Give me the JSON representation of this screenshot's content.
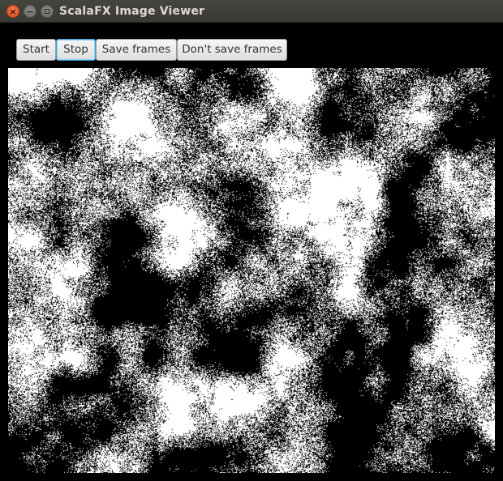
{
  "window": {
    "title": "ScalaFX Image Viewer",
    "controls": {
      "close_glyph": "×",
      "minimize_glyph": "−"
    }
  },
  "toolbar": {
    "buttons": [
      {
        "label": "Start"
      },
      {
        "label": "Stop",
        "focused": true
      },
      {
        "label": "Save frames"
      },
      {
        "label": "Don't save frames"
      }
    ]
  },
  "image": {
    "description_colors": {
      "on": "#000000",
      "off": "#ffffff"
    },
    "accent_focus_color": "#3fa0d6"
  }
}
